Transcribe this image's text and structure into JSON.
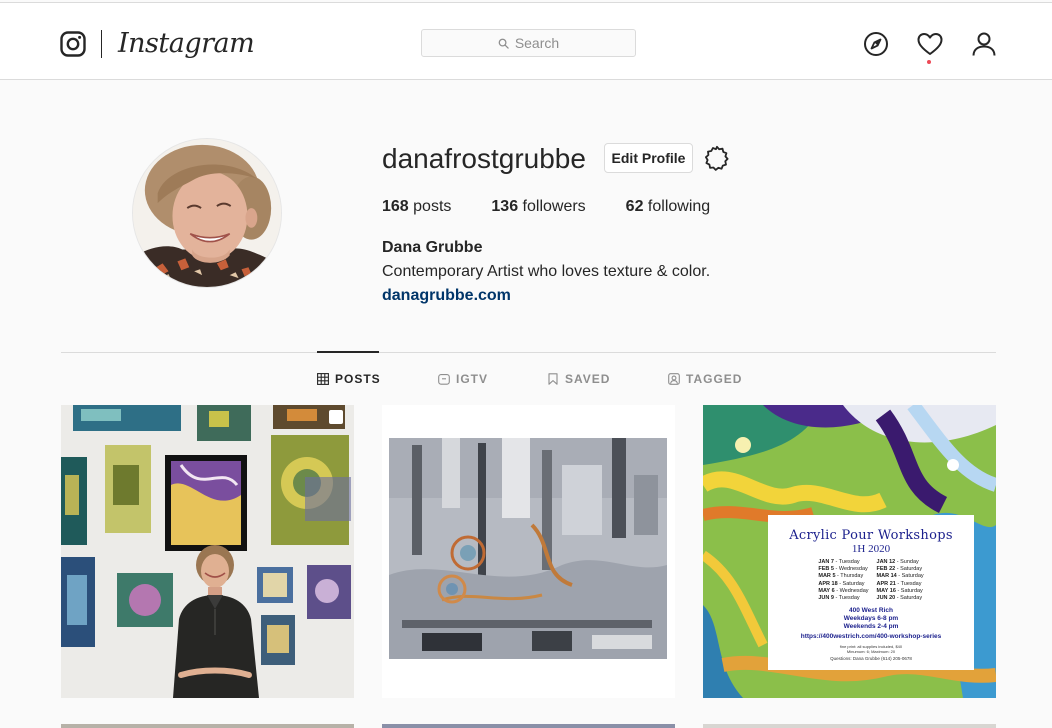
{
  "header": {
    "wordmark": "Instagram",
    "search_placeholder": "Search",
    "icons": [
      "instagram-glyph-icon",
      "search-icon",
      "explore-compass-icon",
      "activity-heart-icon",
      "profile-person-icon"
    ]
  },
  "profile": {
    "username": "danafrostgrubbe",
    "edit_label": "Edit Profile",
    "stats": {
      "posts_count": "168",
      "posts_label": " posts",
      "followers_count": "136",
      "followers_label": " followers",
      "following_count": "62",
      "following_label": " following"
    },
    "full_name": "Dana Grubbe",
    "bio": "Contemporary Artist who loves texture & color.",
    "website": "danagrubbe.com"
  },
  "tabs": [
    {
      "label": "POSTS",
      "icon": "grid-icon",
      "active": true
    },
    {
      "label": "IGTV",
      "icon": "tv-icon",
      "active": false
    },
    {
      "label": "SAVED",
      "icon": "bookmark-icon",
      "active": false
    },
    {
      "label": "TAGGED",
      "icon": "tagged-person-icon",
      "active": false
    }
  ],
  "posts": [
    {
      "kind": "photo",
      "description_icon": "multiple-photos-icon"
    },
    {
      "kind": "painting"
    },
    {
      "kind": "flyer",
      "flyer": {
        "title": "Acrylic Pour Workshops",
        "subtitle": "1H 2020",
        "dates_left": [
          [
            "JAN",
            "7",
            "- Tuesday"
          ],
          [
            "FEB",
            "5",
            "- Wednesday"
          ],
          [
            "MAR",
            "5",
            "- Thursday"
          ],
          [
            "APR",
            "18",
            "- Saturday"
          ],
          [
            "MAY",
            "6",
            "- Wednesday"
          ],
          [
            "JUN",
            "9",
            "- Tuesday"
          ]
        ],
        "dates_right": [
          [
            "JAN",
            "12",
            "- Sunday"
          ],
          [
            "FEB",
            "22",
            "- Saturday"
          ],
          [
            "MAR",
            "14",
            "- Saturday"
          ],
          [
            "APR",
            "21",
            "- Tuesday"
          ],
          [
            "MAY",
            "16",
            "- Saturday"
          ],
          [
            "JUN",
            "20",
            "- Saturday"
          ]
        ],
        "place_line1": "400 West Rich",
        "place_line2": "Weekdays 6-8 pm",
        "place_line3": "Weekends 2-4 pm",
        "url": "https://400westrich.com/400-workshop-series",
        "fine_print": "fine print: all supplies included, $40",
        "fine_print2": "Minumum: 6; Maximum: 20",
        "questions": "Questions: Dana Grubbe (614) 205-0678"
      }
    }
  ],
  "colors": {
    "accent_link": "#003569",
    "notification_dot": "#ed4956",
    "border": "#dbdbdb",
    "text": "#262626",
    "muted": "#8e8e8e"
  }
}
